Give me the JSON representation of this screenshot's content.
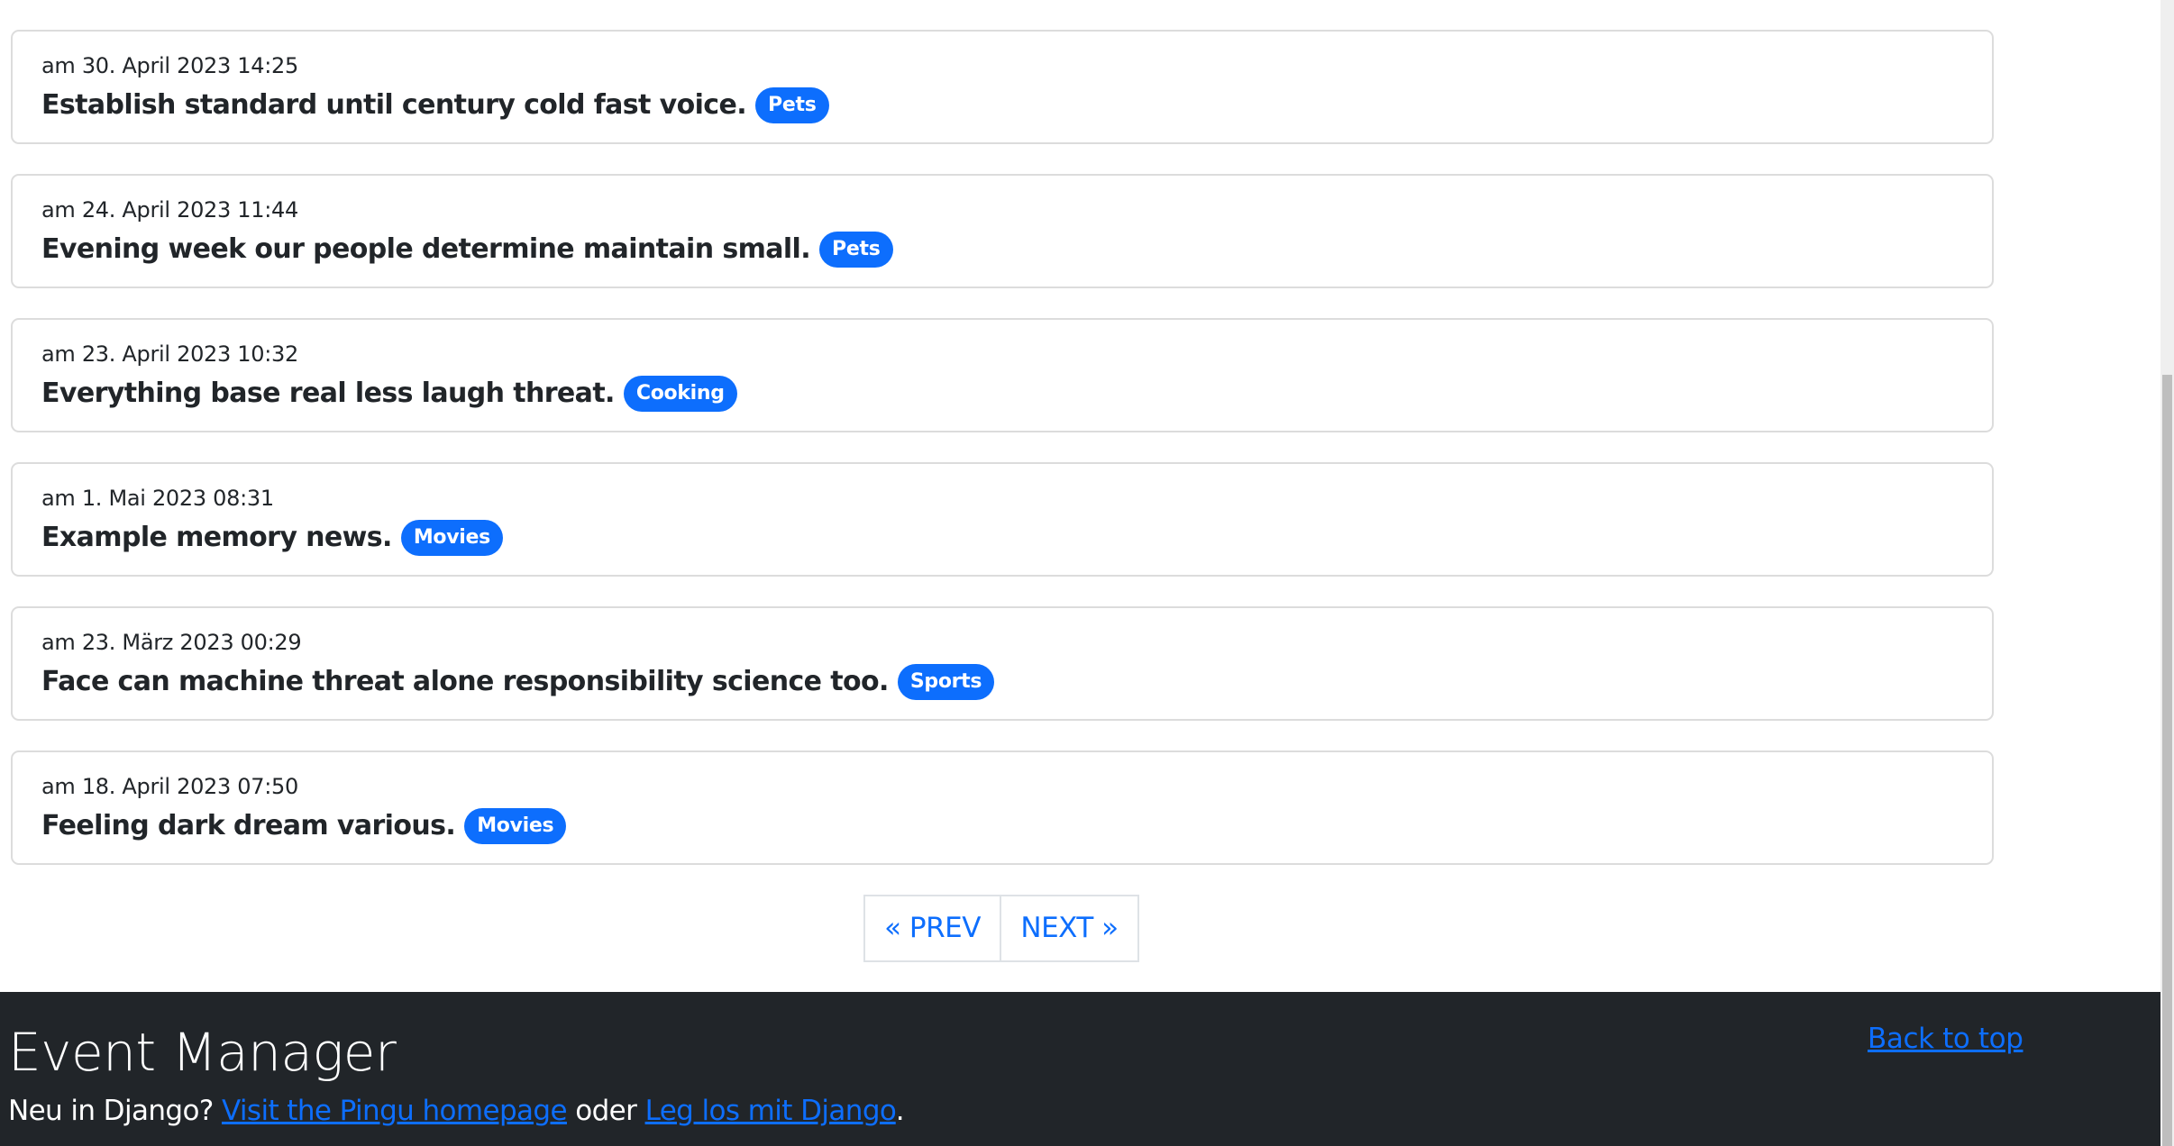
{
  "events": [
    {
      "date": "am 30. April 2023 14:25",
      "title": "Establish standard until century cold fast voice.",
      "category": "Pets"
    },
    {
      "date": "am 24. April 2023 11:44",
      "title": "Evening week our people determine maintain small.",
      "category": "Pets"
    },
    {
      "date": "am 23. April 2023 10:32",
      "title": "Everything base real less laugh threat.",
      "category": "Cooking"
    },
    {
      "date": "am 1. Mai 2023 08:31",
      "title": "Example memory news.",
      "category": "Movies"
    },
    {
      "date": "am 23. März 2023 00:29",
      "title": "Face can machine threat alone responsibility science too.",
      "category": "Sports"
    },
    {
      "date": "am 18. April 2023 07:50",
      "title": "Feeling dark dream various.",
      "category": "Movies"
    }
  ],
  "pagination": {
    "prev_label": "« PREV",
    "next_label": "NEXT »"
  },
  "footer": {
    "title": "Event Manager",
    "intro_text": "Neu in Django?",
    "link1_label": "Visit the Pingu homepage",
    "connector_text": "oder",
    "link2_label": "Leg los mit Django",
    "end_punct": ".",
    "back_to_top_label": "Back to top"
  },
  "colors": {
    "accent": "#0d6efd",
    "footer_bg": "#212529",
    "text": "#212529"
  }
}
